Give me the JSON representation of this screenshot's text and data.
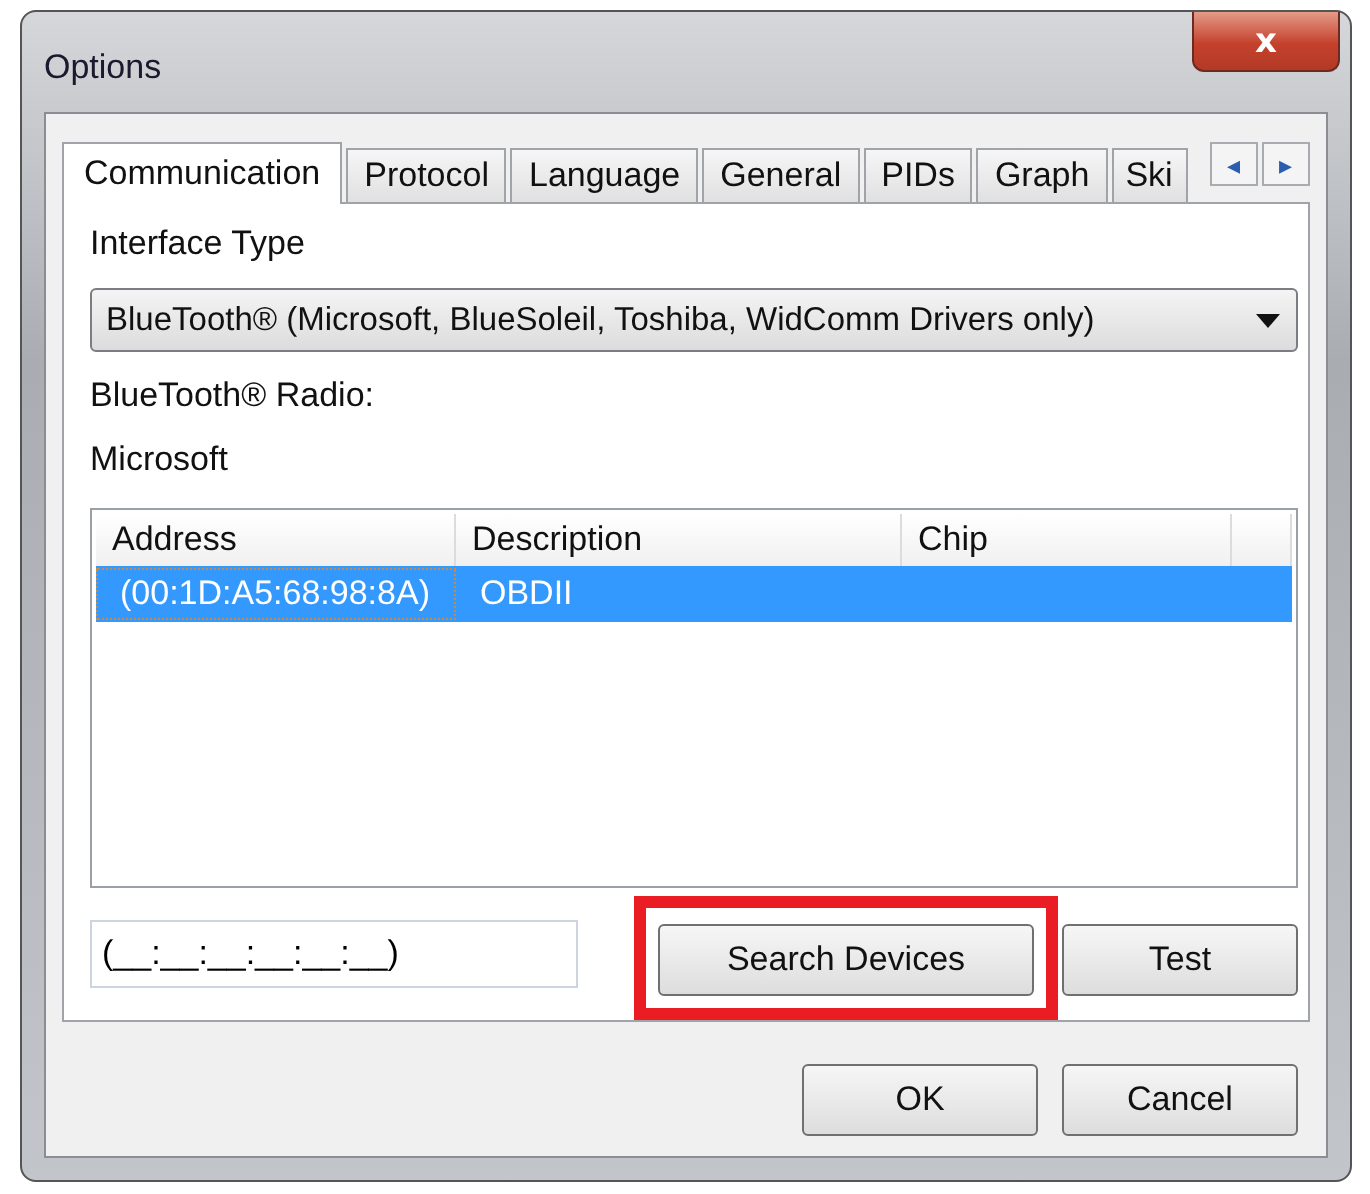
{
  "window": {
    "title": "Options",
    "close_label": "x"
  },
  "tabs": [
    {
      "label": "Communication",
      "selected": true
    },
    {
      "label": "Protocol",
      "selected": false
    },
    {
      "label": "Language",
      "selected": false
    },
    {
      "label": "General",
      "selected": false
    },
    {
      "label": "PIDs",
      "selected": false
    },
    {
      "label": "Graph",
      "selected": false
    },
    {
      "label": "Ski",
      "selected": false
    }
  ],
  "tab_scroll": [
    "◂",
    "▸"
  ],
  "interface_type": {
    "label": "Interface Type",
    "value": "BlueTooth® (Microsoft, BlueSoleil, Toshiba, WidComm Drivers only)"
  },
  "radio_label": "BlueTooth® Radio:",
  "radio_value": "Microsoft",
  "table": {
    "columns": [
      "Address",
      "Description",
      "Chip"
    ],
    "rows": [
      {
        "cells": [
          "(00:1D:A5:68:98:8A)",
          "OBDII",
          ""
        ],
        "selected": true
      }
    ]
  },
  "address_field": {
    "value": "(__:__:__:__:__:__)"
  },
  "panel_buttons": [
    {
      "label": "Search Devices",
      "highlighted": true
    },
    {
      "label": "Test",
      "highlighted": false
    }
  ],
  "buttons": [
    "OK",
    "Cancel"
  ]
}
